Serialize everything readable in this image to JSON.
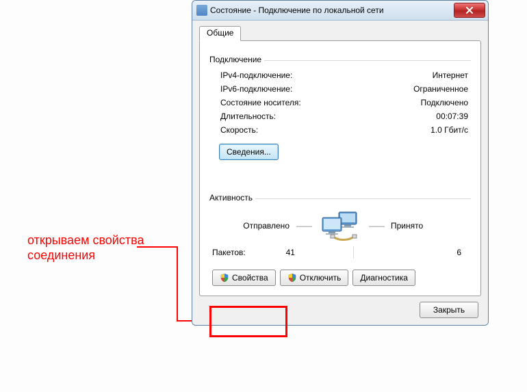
{
  "window": {
    "title": "Состояние - Подключение по локальной сети"
  },
  "tab": {
    "general": "Общие"
  },
  "connection_group": {
    "title": "Подключение",
    "rows": {
      "ipv4_label": "IPv4-подключение:",
      "ipv4_value": "Интернет",
      "ipv6_label": "IPv6-подключение:",
      "ipv6_value": "Ограниченное",
      "media_label": "Состояние носителя:",
      "media_value": "Подключено",
      "duration_label": "Длительность:",
      "duration_value": "00:07:39",
      "speed_label": "Скорость:",
      "speed_value": "1.0 Гбит/с"
    },
    "details_button": "Сведения..."
  },
  "activity_group": {
    "title": "Активность",
    "sent_label": "Отправлено",
    "received_label": "Принято",
    "packets_label": "Пакетов:",
    "packets_sent": "41",
    "packets_received": "6"
  },
  "buttons": {
    "properties": "Свойства",
    "disable": "Отключить",
    "diagnose": "Диагностика",
    "close": "Закрыть"
  },
  "annotation": {
    "line1": "открываем свойства",
    "line2": "соединения"
  }
}
